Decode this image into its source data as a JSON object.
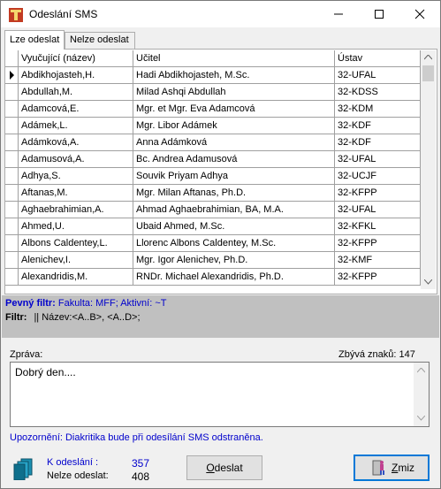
{
  "window": {
    "title": "Odeslání SMS"
  },
  "tabs": [
    {
      "label": "Lze odeslat"
    },
    {
      "label": "Nelze odeslat"
    }
  ],
  "grid": {
    "columns": [
      "Vyučující (název)",
      "Učitel",
      "Ústav"
    ],
    "rows": [
      [
        "Abdikhojasteh,H.",
        "Hadi Abdikhojasteh, M.Sc.",
        "32-UFAL"
      ],
      [
        "Abdullah,M.",
        "Milad Ashqi Abdullah",
        "32-KDSS"
      ],
      [
        "Adamcová,E.",
        "Mgr. et Mgr. Eva Adamcová",
        "32-KDM"
      ],
      [
        "Adámek,L.",
        "Mgr. Libor Adámek",
        "32-KDF"
      ],
      [
        "Adámková,A.",
        "Anna Adámková",
        "32-KDF"
      ],
      [
        "Adamusová,A.",
        "Bc. Andrea Adamusová",
        "32-UFAL"
      ],
      [
        "Adhya,S.",
        "Souvik Priyam Adhya",
        "32-UCJF"
      ],
      [
        "Aftanas,M.",
        "Mgr. Milan Aftanas, Ph.D.",
        "32-KFPP"
      ],
      [
        "Aghaebrahimian,A.",
        "Ahmad Aghaebrahimian, BA, M.A.",
        "32-UFAL"
      ],
      [
        "Ahmed,U.",
        "Ubaid Ahmed, M.Sc.",
        "32-KFKL"
      ],
      [
        "Albons Caldentey,L.",
        "Llorenc Albons Caldentey, M.Sc.",
        "32-KFPP"
      ],
      [
        "Alenichev,I.",
        "Mgr. Igor Alenichev, Ph.D.",
        "32-KMF"
      ],
      [
        "Alexandridis,M.",
        "RNDr. Michael Alexandridis, Ph.D.",
        "32-KFPP"
      ]
    ]
  },
  "filters": {
    "fixed_label": "Pevný filtr:",
    "fixed_value": "Fakulta: MFF; Aktivní: ~T",
    "filter_label": "Filtr:",
    "filter_value": "|| Název:<A..B>, <A..D>;"
  },
  "message": {
    "label": "Zpráva:",
    "remaining_label": "Zbývá znaků:",
    "remaining_value": "147",
    "text": "Dobrý den....",
    "warning": "Upozornění: Diakritika bude při odesílání SMS odstraněna."
  },
  "counts": {
    "k_label": "K odeslání :",
    "k_value": "357",
    "n_label": "Nelze odeslat:",
    "n_value": "408"
  },
  "buttons": {
    "send_prefix": "O",
    "send_rest": "deslat",
    "cancel_prefix": "Z",
    "cancel_rest": "miz"
  }
}
